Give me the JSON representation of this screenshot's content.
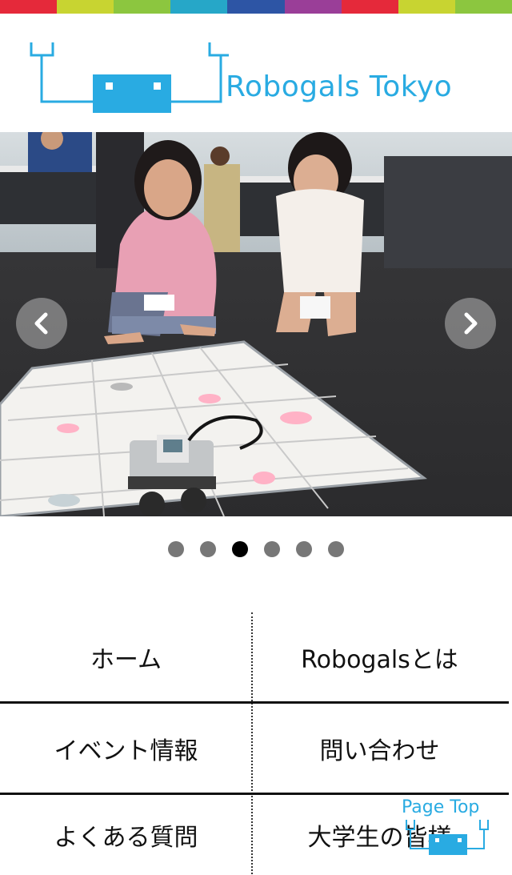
{
  "brand": {
    "name": "Robogals Tokyo",
    "color": "#29abe2",
    "stripe_colors": [
      "#e5293a",
      "#c8d431",
      "#8cc63f",
      "#26a7c8",
      "#2d55a5",
      "#9a3e98",
      "#e5293a",
      "#c8d431",
      "#8cc63f"
    ]
  },
  "slider": {
    "prev_icon": "chevron-left-icon",
    "next_icon": "chevron-right-icon",
    "dot_count": 6,
    "active_index": 3
  },
  "nav": {
    "items": [
      {
        "label": "ホーム"
      },
      {
        "label": "Robogalsとは"
      },
      {
        "label": "イベント情報"
      },
      {
        "label": "問い合わせ"
      },
      {
        "label": "よくある質問"
      },
      {
        "label": "大学生の皆様"
      }
    ]
  },
  "page_top": {
    "label": "Page Top"
  }
}
